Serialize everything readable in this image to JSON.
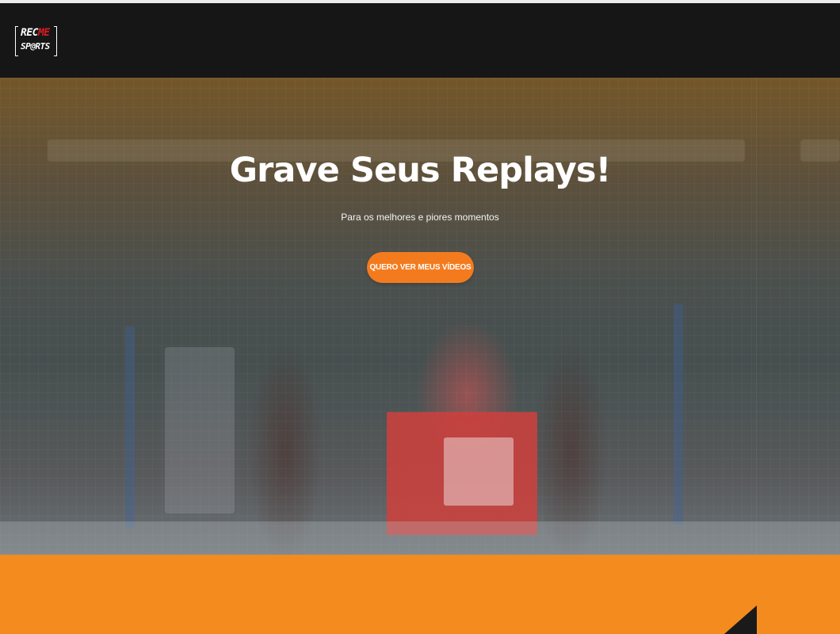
{
  "brand": {
    "line1_prefix": "REC",
    "line1_accent": "ME",
    "line2": "SP@RTS"
  },
  "hero": {
    "title": "Grave Seus Replays!",
    "subtitle": "Para os melhores e piores momentos",
    "cta_label": "QUERO VER MEUS VÍDEOS"
  },
  "colors": {
    "header_background": "#161616",
    "brand_accent": "#d51d24",
    "cta_background": "#f47b1d",
    "section_background": "#f38b1f"
  }
}
